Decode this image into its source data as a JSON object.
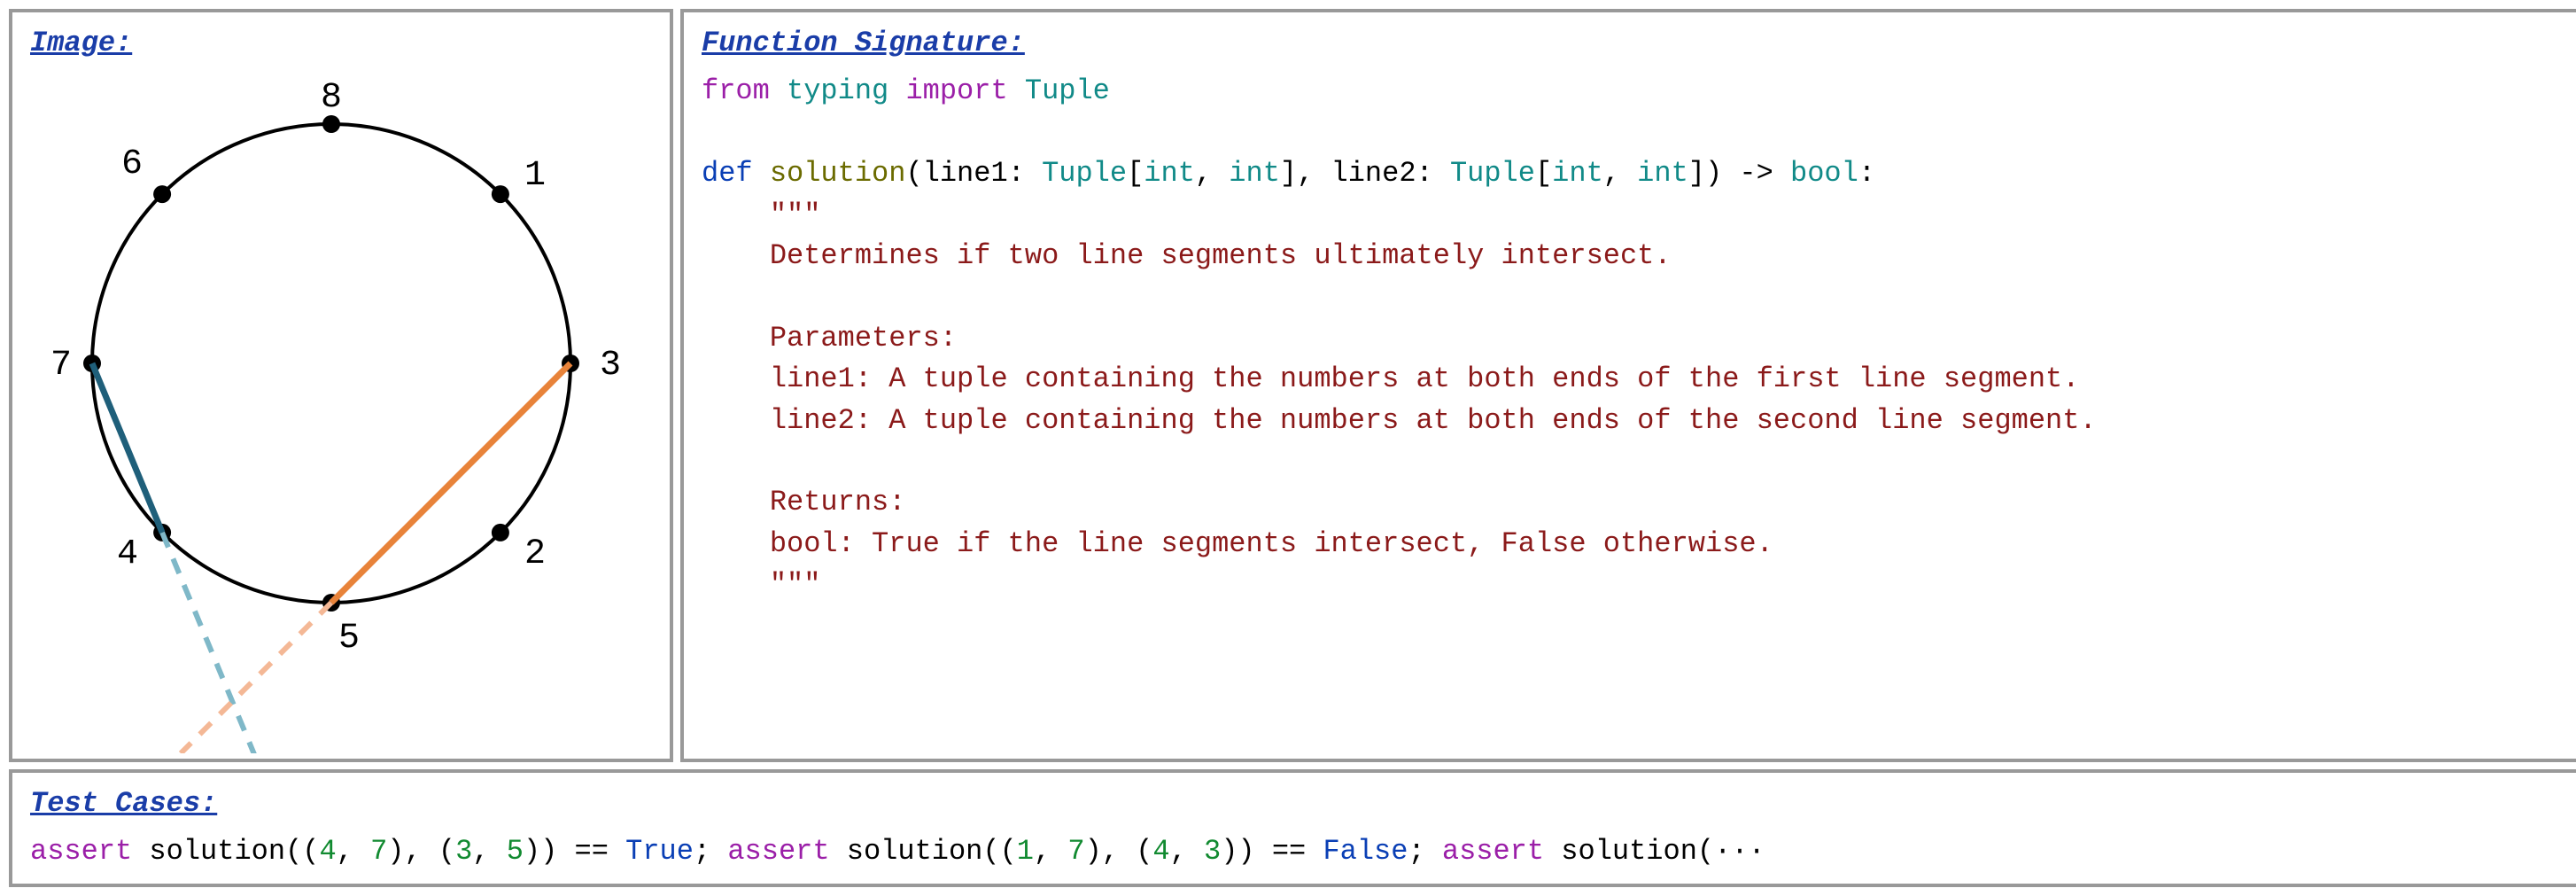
{
  "image_panel": {
    "title": "Image:",
    "points_labels": [
      "8",
      "1",
      "3",
      "2",
      "5",
      "4",
      "7",
      "6"
    ]
  },
  "sig_panel": {
    "title": "Function Signature:",
    "code": {
      "import_line": {
        "from_kw": "from",
        "module": "typing",
        "import_kw": "import",
        "name": "Tuple"
      },
      "def_kw": "def",
      "fn": "solution",
      "params_text": "(line1: Tuple[int, int], line2: Tuple[int, int]) -> bool:",
      "triple_quote": "\"\"\"",
      "doc_lines": [
        "Determines if two line segments ultimately intersect.",
        "",
        "Parameters:",
        "line1: A tuple containing the numbers at both ends of the first line segment.",
        "line2: A tuple containing the numbers at both ends of the second line segment.",
        "",
        "Returns:",
        "bool: True if the line segments intersect, False otherwise."
      ]
    }
  },
  "test_panel": {
    "title": "Test Cases:",
    "asserts": [
      {
        "a1": "4",
        "a2": "7",
        "b1": "3",
        "b2": "5",
        "eq": "True"
      },
      {
        "a1": "1",
        "a2": "7",
        "b1": "4",
        "b2": "3",
        "eq": "False"
      }
    ],
    "trailing": "assert solution(···"
  },
  "chart_data": {
    "type": "diagram",
    "title": "Circle with 8 labeled points and two chords",
    "n_points": 8,
    "point_labels_clockwise_from_top": [
      8,
      1,
      3,
      2,
      5,
      4,
      7,
      6
    ],
    "chords": [
      {
        "from": 7,
        "to": 4,
        "color": "#1f5f7a",
        "style": "solid",
        "extended_dashed": true
      },
      {
        "from": 3,
        "to": 5,
        "color": "#e8833a",
        "style": "solid",
        "extended_dashed": true
      }
    ],
    "intersection_shown_outside_circle": true
  }
}
